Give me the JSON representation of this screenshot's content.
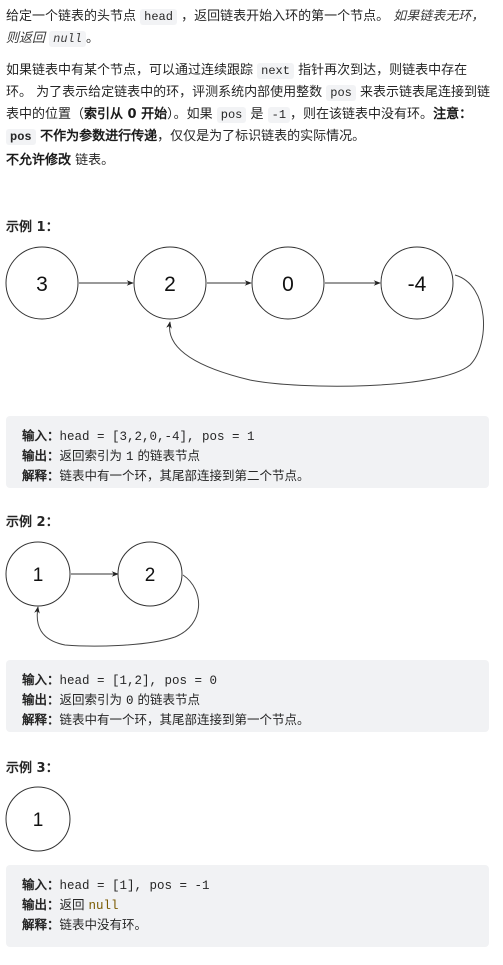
{
  "intro": {
    "p1_a": "给定一个链表的头节点 ",
    "p1_code_head": "head",
    "p1_b": " ，返回链表开始入环的第一个节点。 ",
    "p1_italic_a": "如果链表无环，",
    "p1_italic_b": "则返回 ",
    "p1_code_null": "null",
    "p1_end": "。",
    "p2_a": "如果链表中有某个节点，可以通过连续跟踪 ",
    "p2_code_next": "next",
    "p2_b": " 指针再次到达，则链表中存在",
    "p2_c": "环。 为了表示给定链表中的环，评测系统内部使用整数 ",
    "p2_code_pos1": "pos",
    "p2_d": " 来表示链表尾连接到链",
    "p2_e": "表中的位置（",
    "p2_bold_index": "索引从 0 开始",
    "p2_f": "）。如果 ",
    "p2_code_pos2": "pos",
    "p2_g": " 是 ",
    "p2_code_neg1": "-1",
    "p2_h": "，则在该链表中没有环。",
    "p2_bold_note": "注意：",
    "p2_code_pos3": "pos",
    "p2_bold_not_param": " 不作为参数进行传递",
    "p2_i": "，仅仅是为了标识链表的实际情况。",
    "p3_bold": "不允许修改",
    "p3_rest": " 链表。"
  },
  "examples": [
    {
      "title": "示例 1：",
      "nodes": [
        "3",
        "2",
        "0",
        "-4"
      ],
      "cycle_to_index": 1,
      "input_label": "输入：",
      "input_value": "head = [3,2,0,-4], pos = 1",
      "output_label": "输出：",
      "output_a": "返回索引为 ",
      "output_num": "1",
      "output_b": " 的链表节点",
      "explain_label": "解释：",
      "explain_value": "链表中有一个环，其尾部连接到第二个节点。"
    },
    {
      "title": "示例 2：",
      "nodes": [
        "1",
        "2"
      ],
      "cycle_to_index": 0,
      "input_label": "输入：",
      "input_value": "head = [1,2], pos = 0",
      "output_label": "输出：",
      "output_a": "返回索引为 ",
      "output_num": "0",
      "output_b": " 的链表节点",
      "explain_label": "解释：",
      "explain_value": "链表中有一个环，其尾部连接到第一个节点。"
    },
    {
      "title": "示例 3：",
      "nodes": [
        "1"
      ],
      "cycle_to_index": -1,
      "input_label": "输入：",
      "input_value": "head = [1], pos = -1",
      "output_label": "输出：",
      "output_a": "返回 ",
      "output_null": "null",
      "explain_label": "解释：",
      "explain_value": "链表中没有环。"
    }
  ],
  "colors": {
    "code_bg": "#f2f3f5",
    "example_bg": "#f1f2f4",
    "text": "#262626",
    "null_keyword": "#7a5a00"
  }
}
